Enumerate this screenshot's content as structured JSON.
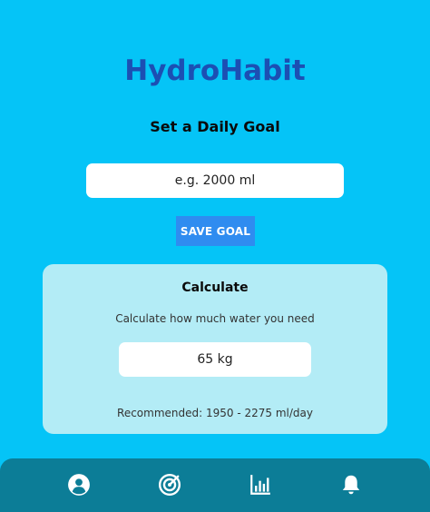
{
  "app": {
    "title": "HydroHabit"
  },
  "goal": {
    "heading": "Set a Daily Goal",
    "placeholder": "e.g. 2000 ml",
    "save_label": "SAVE GOAL"
  },
  "calculator": {
    "title": "Calculate",
    "description": "Calculate how much water you need",
    "weight_value": "65 kg",
    "recommendation": "Recommended: 1950 - 2275 ml/day"
  },
  "nav": {
    "items": [
      {
        "icon": "profile-icon"
      },
      {
        "icon": "target-icon"
      },
      {
        "icon": "stats-icon"
      },
      {
        "icon": "bell-icon"
      }
    ]
  },
  "colors": {
    "background": "#05c4f7",
    "title": "#1c4fb3",
    "button": "#2f8cf0",
    "card": "#b3ecf6",
    "nav": "#0c7d97"
  }
}
